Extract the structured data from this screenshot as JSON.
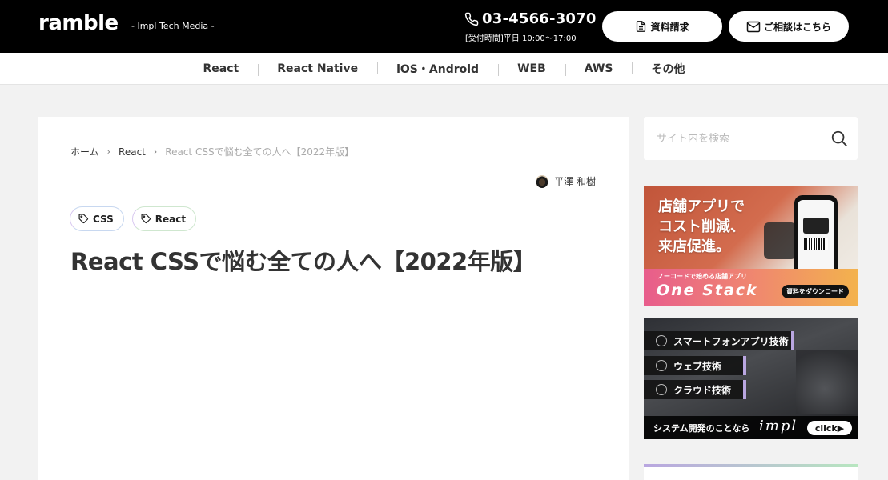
{
  "header": {
    "logo": "ramble",
    "tagline": "- Impl Tech Media -",
    "phone": "03-4566-3070",
    "hours": "[受付時間]平日 10:00〜17:00",
    "docs_button": "資料請求",
    "contact_button": "ご相談はこちら"
  },
  "nav": {
    "items": [
      {
        "label": "React"
      },
      {
        "label": "React Native"
      },
      {
        "label": "iOS・Android"
      },
      {
        "label": "WEB"
      },
      {
        "label": "AWS"
      },
      {
        "label": "その他"
      }
    ]
  },
  "article": {
    "breadcrumb": [
      "ホーム",
      "React",
      "React CSSで悩む全ての人へ【2022年版】"
    ],
    "author": "平澤 和樹",
    "tags": [
      "CSS",
      "React"
    ],
    "title": "React CSSで悩む全ての人へ【2022年版】"
  },
  "sidebar": {
    "search_placeholder": "サイト内を検索",
    "banner1": {
      "headline_lines": [
        "店舗アプリで",
        "コスト削減、",
        "来店促進。"
      ],
      "small_text": "ノーコードで始める店舗アプリ",
      "brand": "One Stack",
      "button": "資料をダウンロード"
    },
    "banner2": {
      "items": [
        "スマートフォンアプリ技術",
        "ウェブ技術",
        "クラウド技術"
      ],
      "caption": "システム開発のことなら",
      "brand": "impl",
      "button": "click▶"
    }
  },
  "colors": {
    "header_bg": "#000000",
    "page_bg": "#f2f2f2",
    "tag_border_accent": "#b9a6e0",
    "tag_border_green": "#b8e6c0"
  }
}
